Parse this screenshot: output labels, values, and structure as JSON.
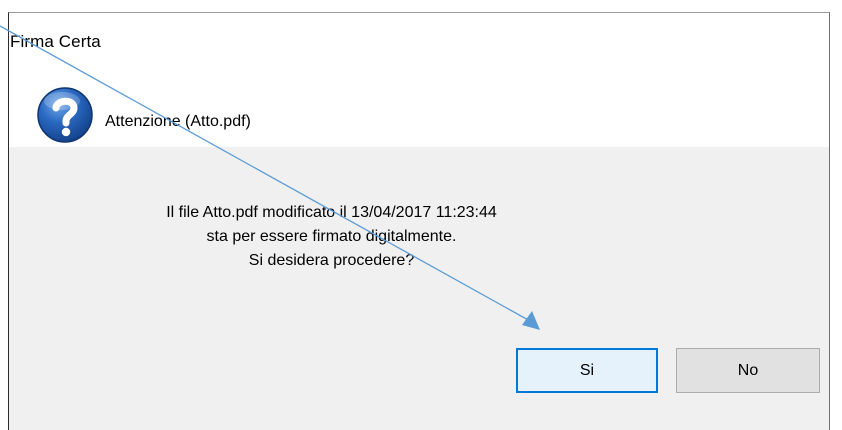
{
  "window": {
    "title": "Firma Certa"
  },
  "header": {
    "icon": "question-icon",
    "text": "Attenzione (Atto.pdf)"
  },
  "message": {
    "lines": [
      "Il file Atto.pdf modificato il 13/04/2017 11:23:44",
      "sta per essere firmato digitalmente.",
      "Si desidera procedere?"
    ]
  },
  "buttons": {
    "yes_label": "Si",
    "no_label": "No"
  },
  "annotation": {
    "type": "arrow",
    "color": "#5b9bd5"
  },
  "colors": {
    "accent": "#0078d7",
    "icon_blue": "#1e5aa8"
  }
}
